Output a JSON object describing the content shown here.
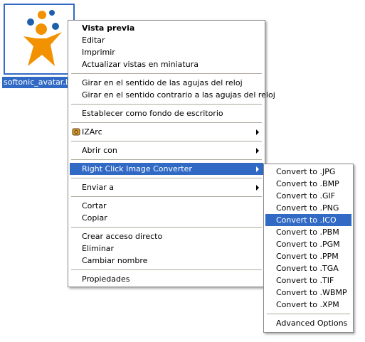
{
  "file": {
    "name": "softonic_avatar.bmp",
    "label": "softonic_avatar.bm",
    "icon": "softonic-star-logo",
    "colors": {
      "orange": "#f39200",
      "blue": "#1d5fab",
      "selection": "#316ac5"
    }
  },
  "context_menu": {
    "groups": [
      [
        {
          "label": "Vista previa",
          "bold": true
        },
        {
          "label": "Editar"
        },
        {
          "label": "Imprimir"
        },
        {
          "label": "Actualizar vistas en miniatura"
        }
      ],
      [
        {
          "label": "Girar en el sentido de las agujas del reloj"
        },
        {
          "label": "Girar en el sentido contrario a las agujas del reloj"
        }
      ],
      [
        {
          "label": "Establecer como fondo de escritorio"
        }
      ],
      [
        {
          "label": "IZArc",
          "submenu": true,
          "icon": "izarc-archive-icon"
        }
      ],
      [
        {
          "label": "Abrir con",
          "submenu": true
        }
      ],
      [
        {
          "label": "Right Click Image Converter",
          "submenu": true,
          "highlighted": true
        }
      ],
      [
        {
          "label": "Enviar a",
          "submenu": true
        }
      ],
      [
        {
          "label": "Cortar"
        },
        {
          "label": "Copiar"
        }
      ],
      [
        {
          "label": "Crear acceso directo"
        },
        {
          "label": "Eliminar"
        },
        {
          "label": "Cambiar nombre"
        }
      ],
      [
        {
          "label": "Propiedades"
        }
      ]
    ]
  },
  "converter_submenu": {
    "items": [
      {
        "label": "Convert to .JPG"
      },
      {
        "label": "Convert to .BMP"
      },
      {
        "label": "Convert to .GIF"
      },
      {
        "label": "Convert to .PNG"
      },
      {
        "label": "Convert to .ICO",
        "highlighted": true
      },
      {
        "label": "Convert to .PBM"
      },
      {
        "label": "Convert to .PGM"
      },
      {
        "label": "Convert to .PPM"
      },
      {
        "label": "Convert to .TGA"
      },
      {
        "label": "Convert to .TIF"
      },
      {
        "label": "Convert to .WBMP"
      },
      {
        "label": "Convert to .XPM"
      }
    ],
    "footer": {
      "label": "Advanced Options"
    }
  }
}
